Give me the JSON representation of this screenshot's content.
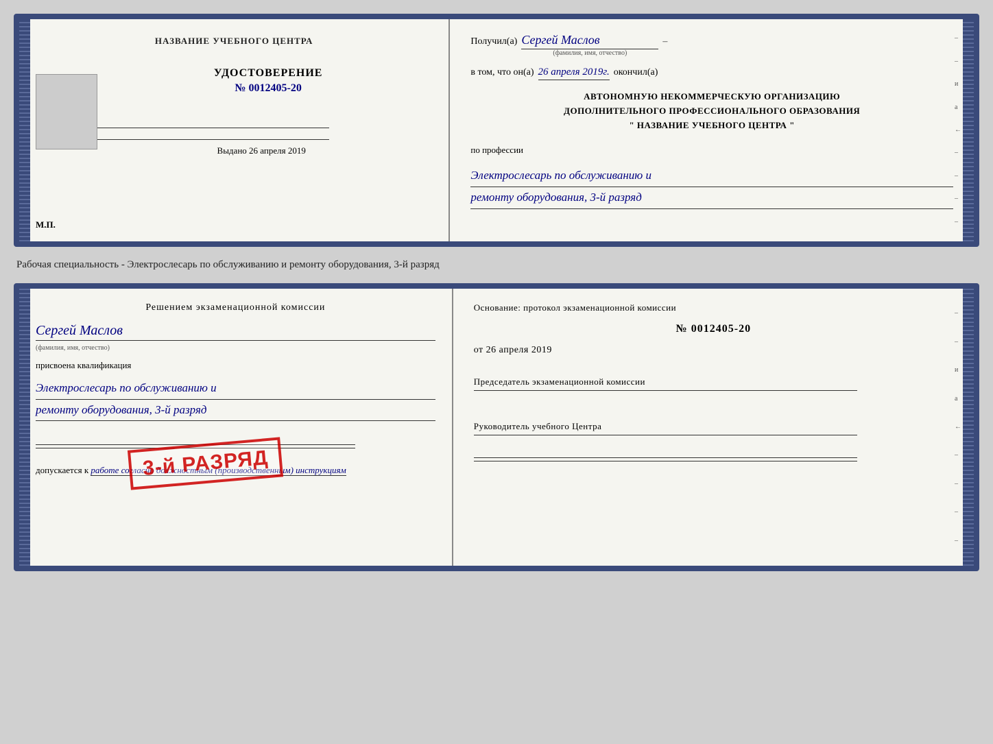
{
  "top_cert": {
    "left": {
      "header": "НАЗВАНИЕ УЧЕБНОГО ЦЕНТРА",
      "udostoverenie_title": "УДОСТОВЕРЕНИЕ",
      "udostoverenie_number": "№ 0012405-20",
      "signature_label": "",
      "vydano_label": "Выдано",
      "vydano_date": "26 апреля 2019",
      "mp_label": "М.П."
    },
    "right": {
      "poluchil_label": "Получил(а)",
      "poluchil_name": "Сергей Маслов",
      "fio_sub": "(фамилия, имя, отчество)",
      "dash": "–",
      "vtom_label": "в том, что он(а)",
      "vtom_date": "26 апреля 2019г.",
      "okончил_label": "окончил(а)",
      "org_line1": "АВТОНОМНУЮ НЕКОММЕРЧЕСКУЮ ОРГАНИЗАЦИЮ",
      "org_line2": "ДОПОЛНИТЕЛЬНОГО ПРОФЕССИОНАЛЬНОГО ОБРАЗОВАНИЯ",
      "org_line3": "\"   НАЗВАНИЕ УЧЕБНОГО ЦЕНТРА   \"",
      "po_professii_label": "по профессии",
      "profession_line1": "Электрослесарь по обслуживанию и",
      "profession_line2": "ремонту оборудования, 3-й разряд"
    }
  },
  "specialty_text": "Рабочая специальность - Электрослесарь по обслуживанию и ремонту оборудования, 3-й разряд",
  "bottom_cert": {
    "left": {
      "resheniem_title": "Решением экзаменационной комиссии",
      "person_name": "Сергей Маслов",
      "fio_sub": "(фамилия, имя, отчество)",
      "prisvoena_label": "присвоена квалификация",
      "qualification_line1": "Электрослесарь по обслуживанию и",
      "qualification_line2": "ремонту оборудования, 3-й разряд",
      "dopuskaetsya_label": "допускается к",
      "dopuskaetsya_text": "работе согласно должностным (производственным) инструкциям"
    },
    "right": {
      "osnovaniye_label": "Основание: протокол экзаменационной комиссии",
      "protocol_number": "№  0012405-20",
      "ot_label": "от",
      "ot_date": "26 апреля 2019",
      "chairman_label": "Председатель экзаменационной комиссии",
      "rukovoditel_label": "Руководитель учебного Центра"
    },
    "stamp": "3-й РАЗРЯД"
  }
}
